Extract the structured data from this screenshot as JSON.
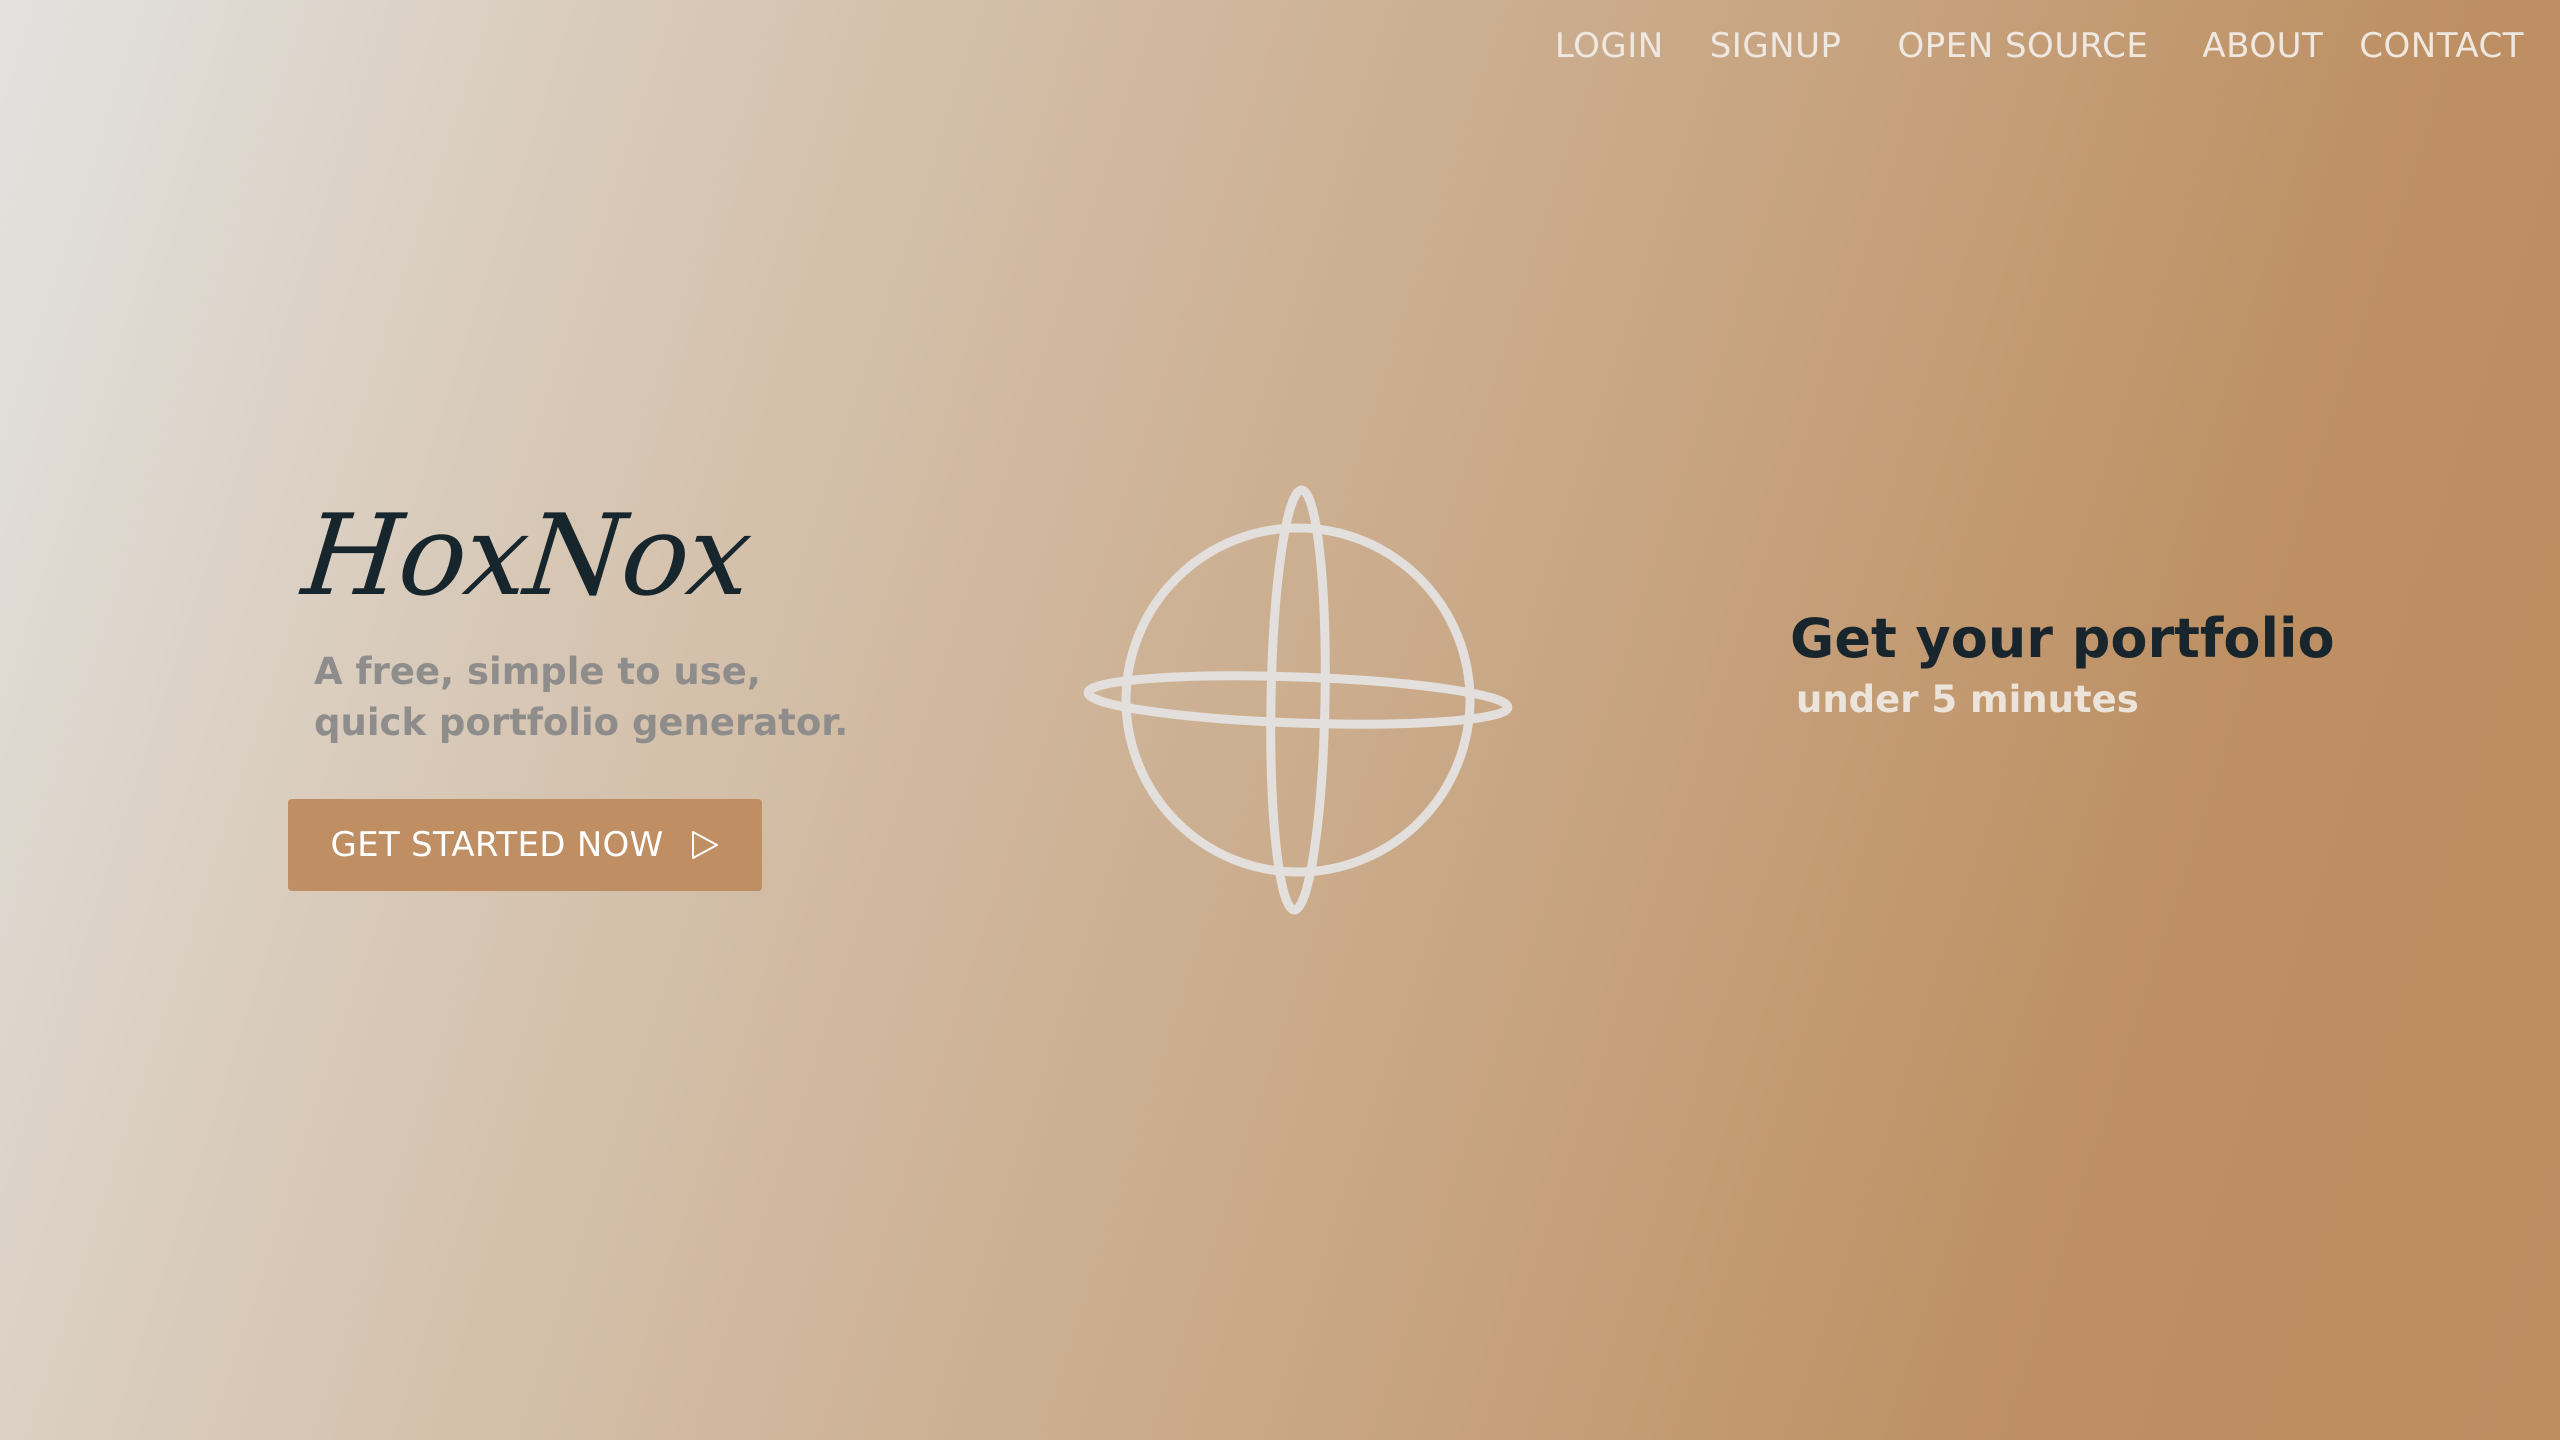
{
  "nav": {
    "items": [
      {
        "label": "LOGIN"
      },
      {
        "label": "SIGNUP"
      },
      {
        "label": "OPEN SOURCE"
      },
      {
        "label": "ABOUT"
      },
      {
        "label": "CONTACT"
      }
    ]
  },
  "hero": {
    "logo": "HoxNox",
    "tagline_line1": "A free, simple to use,",
    "tagline_line2": "quick portfolio generator.",
    "cta_label": "GET STARTED NOW",
    "cta_icon": "play-outline-icon",
    "illustration_icon": "globe-icon",
    "headline": "Get your portfolio",
    "subline": "under 5 minutes"
  },
  "colors": {
    "accent": "#bf8e62",
    "dark_text": "#18252c",
    "muted_text": "#8e8d8c",
    "light_text": "#efe8e1"
  }
}
